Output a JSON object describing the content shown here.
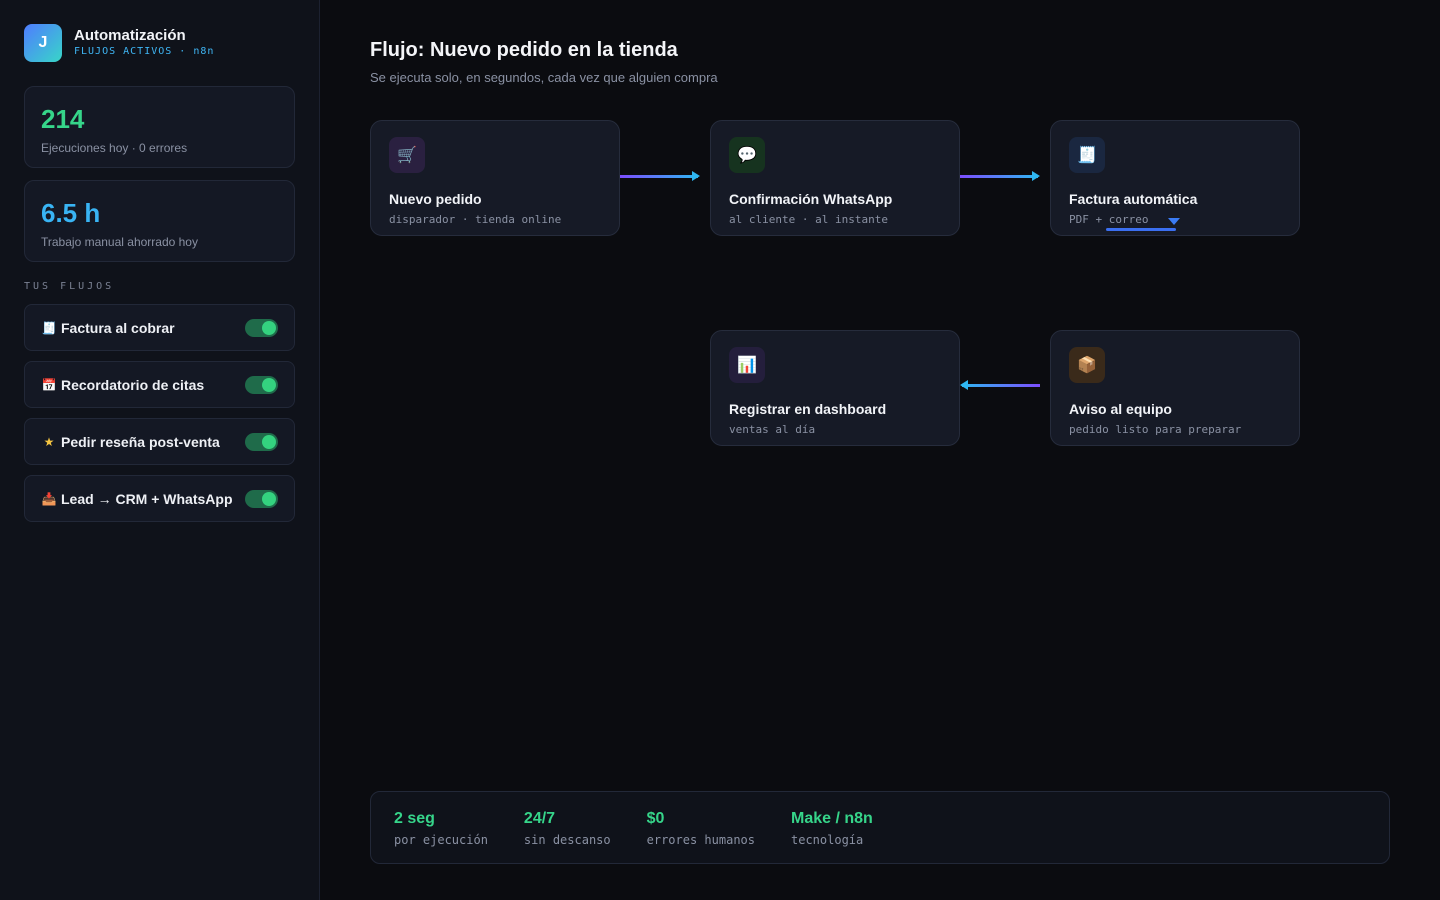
{
  "brand": {
    "logo_letter": "J",
    "title": "Automatización",
    "subtitle": "FLUJOS ACTIVOS · n8n"
  },
  "stats": [
    {
      "value": "214",
      "label": "Ejecuciones hoy · 0 errores",
      "color": "#36d58a"
    },
    {
      "value": "6.5 h",
      "label": "Trabajo manual ahorrado hoy",
      "color": "#39b4f4"
    }
  ],
  "sidebar": {
    "section_label": "TUS FLUJOS",
    "flows": [
      {
        "icon": "receipt-icon",
        "emoji": "🧾",
        "label": "Factura al cobrar",
        "enabled": true
      },
      {
        "icon": "calendar-icon",
        "emoji": "📅",
        "label": "Recordatorio de citas",
        "enabled": true
      },
      {
        "icon": "star-icon",
        "emoji": "★",
        "label": "Pedir reseña post-venta",
        "enabled": true
      },
      {
        "icon": "inbox-icon",
        "emoji": "📥",
        "label": "Lead → CRM + WhatsApp",
        "enabled": true
      }
    ]
  },
  "main": {
    "title": "Flujo: Nuevo pedido en la tienda",
    "subtitle": "Se ejecuta solo, en segundos, cada vez que alguien compra"
  },
  "nodes": [
    {
      "id": "nuevo-pedido",
      "icon": "cart-icon",
      "emoji": "🛒",
      "icon_bg": "#2a2040",
      "title": "Nuevo pedido",
      "sub": "disparador · tienda online"
    },
    {
      "id": "whatsapp",
      "icon": "chat-icon",
      "emoji": "💬",
      "icon_bg": "#16331f",
      "title": "Confirmación WhatsApp",
      "sub": "al cliente · al instante"
    },
    {
      "id": "factura",
      "icon": "receipt-icon",
      "emoji": "🧾",
      "icon_bg": "#1a2740",
      "title": "Factura automática",
      "sub": "PDF + correo"
    },
    {
      "id": "dashboard",
      "icon": "chart-icon",
      "emoji": "📊",
      "icon_bg": "#241e3c",
      "title": "Registrar en dashboard",
      "sub": "ventas al día"
    },
    {
      "id": "aviso",
      "icon": "package-icon",
      "emoji": "📦",
      "icon_bg": "#3a2a1a",
      "title": "Aviso al equipo",
      "sub": "pedido listo para preparar"
    }
  ],
  "metrics": [
    {
      "value": "2 seg",
      "label": "por ejecución"
    },
    {
      "value": "24/7",
      "label": "sin descanso"
    },
    {
      "value": "$0",
      "label": "errores humanos"
    },
    {
      "value": "Make / n8n",
      "label": "tecnología"
    }
  ],
  "colors": {
    "accent_green": "#36d58a",
    "accent_blue": "#39b4f4",
    "connector_start": "#7c4dff",
    "connector_end": "#2fb8f2"
  }
}
